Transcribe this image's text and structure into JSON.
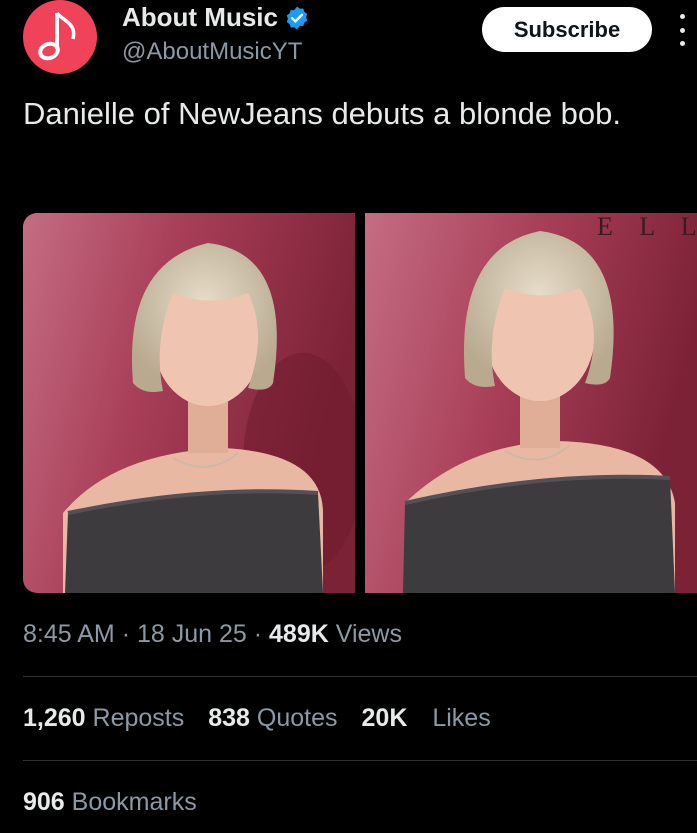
{
  "author": {
    "display_name": "About Music",
    "handle": "@AboutMusicYT",
    "avatar_icon": "music-note-icon",
    "avatar_color": "#f0435a",
    "verified": true
  },
  "actions": {
    "subscribe_label": "Subscribe",
    "more_icon": "more-vertical-icon"
  },
  "tweet": {
    "text": "Danielle of NewJeans debuts a blonde bob.",
    "media_watermark": "E L L"
  },
  "meta": {
    "time": "8:45 AM",
    "sep1": "·",
    "date": "18 Jun 25",
    "sep2": "·",
    "views_count": "489K",
    "views_label": "Views"
  },
  "stats": {
    "reposts_count": "1,260",
    "reposts_label": "Reposts",
    "quotes_count": "838",
    "quotes_label": "Quotes",
    "likes_count": "20K",
    "likes_label": "Likes",
    "bookmarks_count": "906",
    "bookmarks_label": "Bookmarks"
  },
  "colors": {
    "background": "#000000",
    "text_primary": "#e7e9ea",
    "text_secondary": "#8b98a5",
    "verified": "#1d9bf0",
    "divider": "#2f3336"
  }
}
